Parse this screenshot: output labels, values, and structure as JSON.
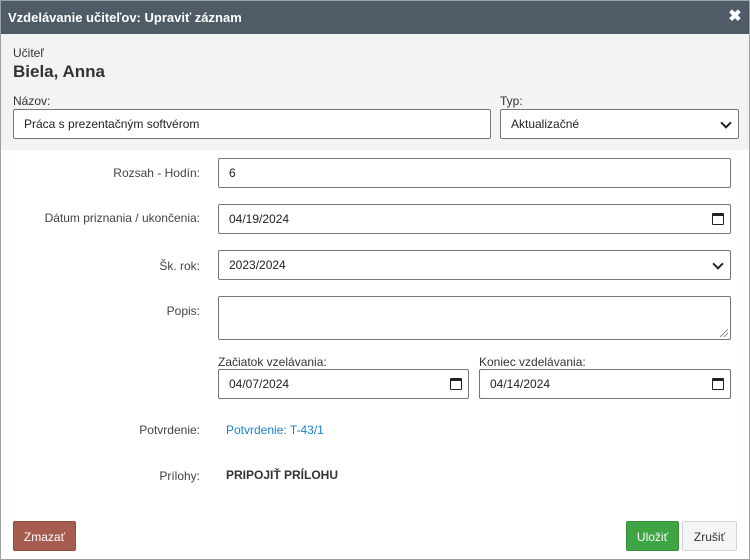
{
  "dialog": {
    "title": "Vzdelávanie učiteľov: Upraviť záznam",
    "close_symbol": "✖"
  },
  "teacher": {
    "label": "Učiteľ",
    "name": "Biela, Anna"
  },
  "name_field": {
    "label": "Názov:",
    "value": "Práca s prezentačným softvérom"
  },
  "type_field": {
    "label": "Typ:",
    "value": "Aktualizačné"
  },
  "hours_field": {
    "label": "Rozsah - Hodín:",
    "value": "6"
  },
  "grant_date_field": {
    "label": "Dátum priznania / ukončenia:",
    "value": "04/19/2024"
  },
  "school_year_field": {
    "label": "Šk. rok:",
    "value": "2023/2024"
  },
  "description_field": {
    "label": "Popis:",
    "value": ""
  },
  "start_field": {
    "label": "Začiatok vzelávania:",
    "value": "04/07/2024"
  },
  "end_field": {
    "label": "Koniec vzdelávania:",
    "value": "04/14/2024"
  },
  "confirmation": {
    "label": "Potvrdenie:",
    "link": "Potvrdenie: T-43/1"
  },
  "attachments": {
    "label": "Prílohy:",
    "action": "PRIPOJIŤ PRÍLOHU"
  },
  "buttons": {
    "delete": "Zmazať",
    "save": "Uložiť",
    "cancel": "Zrušiť"
  },
  "colors": {
    "titlebar": "#4f5b66",
    "delete": "#a65d4f",
    "save": "#3fa444",
    "link": "#1a7fd1"
  }
}
